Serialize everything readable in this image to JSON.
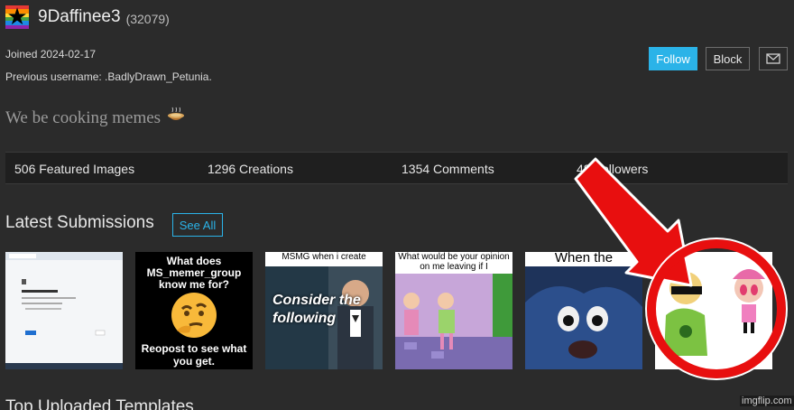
{
  "profile": {
    "username": "9Daffinee3",
    "points": "(32079)",
    "joined": "Joined 2024-02-17",
    "previous_username": "Previous username: .BadlyDrawn_Petunia.",
    "bio": "We be cooking memes",
    "bio_emoji_icon": "cooking-pot-icon"
  },
  "actions": {
    "follow_label": "Follow",
    "block_label": "Block",
    "message_icon": "envelope-icon"
  },
  "stats": {
    "featured": "506 Featured Images",
    "creations": "1296 Creations",
    "comments": "1354 Comments",
    "followers": "48 Followers"
  },
  "submissions": {
    "title": "Latest Submissions",
    "see_all_label": "See All",
    "items": [
      {
        "kind": "screenshot",
        "caption": "This site can't be reached"
      },
      {
        "kind": "text-meme",
        "top": "What does MS_memer_group know me for?",
        "bottom": "Reopost to see what you get."
      },
      {
        "kind": "photo",
        "top": "MSMG when i create",
        "overlay": "Consider the following"
      },
      {
        "kind": "cartoon",
        "top": "What would be your opinion on me leaving if I"
      },
      {
        "kind": "photo",
        "top": "When the"
      },
      {
        "kind": "cartoon-prohibited"
      }
    ]
  },
  "templates": {
    "title": "Top Uploaded Templates"
  },
  "watermark": "imgflip.com",
  "colors": {
    "background": "#2b2b2b",
    "accent": "#2bb3e8",
    "annotation": "#e80f0f"
  }
}
